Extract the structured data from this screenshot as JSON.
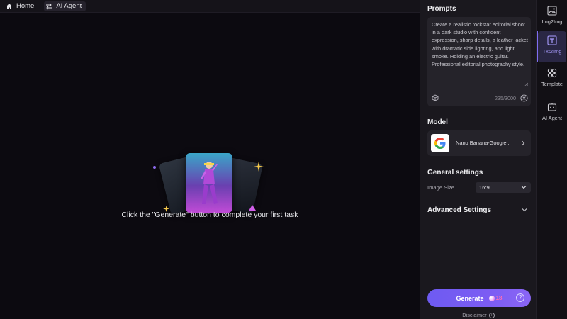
{
  "topbar": {
    "home_label": "Home",
    "agent_label": "AI Agent"
  },
  "canvas": {
    "hint": "Click the \"Generate\" button to complete your first task"
  },
  "panel": {
    "prompts_title": "Prompts",
    "prompt_text": "Create a realistic rockstar editorial shoot in a dark studio with confident expression, sharp details, a leather jacket with dramatic side lighting, and light smoke. Holding an electric guitar. Professional editorial photography style.",
    "char_count": "235/3000",
    "model_title": "Model",
    "model_name": "Nano Banana-Google...",
    "general_title": "General settings",
    "image_size_label": "Image Size",
    "image_size_value": "16:9",
    "advanced_title": "Advanced Settings",
    "generate_label": "Generate",
    "credits": "18",
    "help_glyph": "?",
    "disclaimer": "Disclaimer",
    "info_glyph": "i"
  },
  "rail": {
    "items": [
      {
        "label": "Img2Img",
        "icon": "image-icon"
      },
      {
        "label": "Txt2Img",
        "icon": "text-image-icon"
      },
      {
        "label": "Template",
        "icon": "grid-icon"
      },
      {
        "label": "AI Agent",
        "icon": "agent-icon"
      }
    ]
  },
  "colors": {
    "accent": "#7c5cf3",
    "background": "#0c0a10",
    "panel": "#1a181e",
    "credits": "#ff6fb2"
  }
}
